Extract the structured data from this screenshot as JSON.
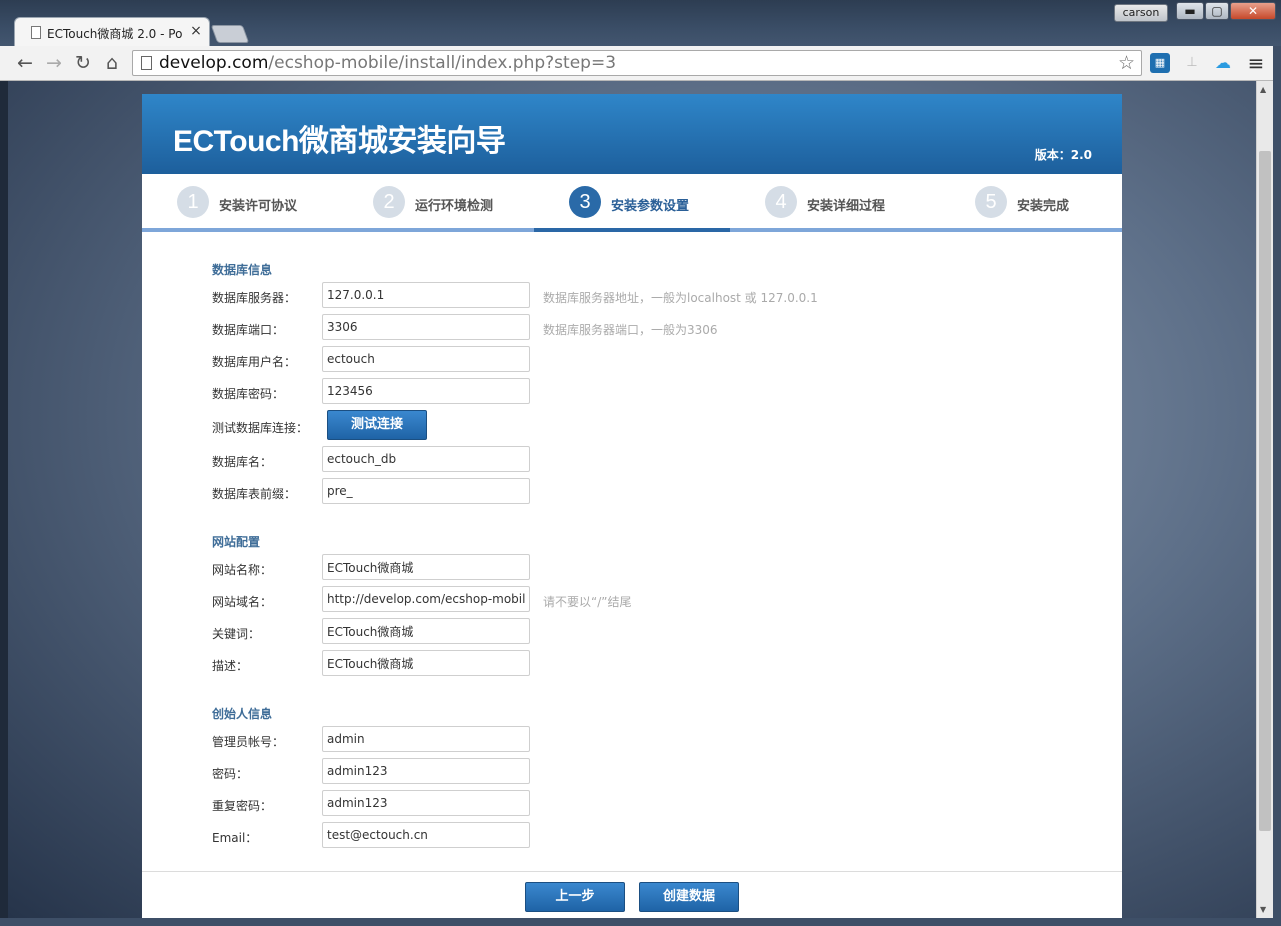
{
  "browser": {
    "tab_title": "ECTouch微商城 2.0 - Po",
    "tab_close": "×",
    "user": "carson",
    "minimize": "▬",
    "maximize": "▢",
    "close": "✕",
    "url_host": "develop.com",
    "url_path": "/ecshop-mobile/install/index.php?step=3",
    "back": "←",
    "forward": "→",
    "reload": "↻",
    "home": "⌂",
    "star": "☆",
    "menu": "≡"
  },
  "header": {
    "title": "ECTouch微商城安装向导",
    "version": "版本：2.0"
  },
  "steps": [
    {
      "num": "1",
      "label": "安装许可协议"
    },
    {
      "num": "2",
      "label": "运行环境检测"
    },
    {
      "num": "3",
      "label": "安装参数设置"
    },
    {
      "num": "4",
      "label": "安装详细过程"
    },
    {
      "num": "5",
      "label": "安装完成"
    }
  ],
  "active_step": 3,
  "database": {
    "title": "数据库信息",
    "host_label": "数据库服务器：",
    "host_value": "127.0.0.1",
    "host_hint": "数据库服务器地址，一般为localhost 或 127.0.0.1",
    "port_label": "数据库端口：",
    "port_value": "3306",
    "port_hint": "数据库服务器端口，一般为3306",
    "user_label": "数据库用户名：",
    "user_value": "ectouch",
    "pass_label": "数据库密码：",
    "pass_value": "123456",
    "test_label": "测试数据库连接：",
    "test_button": "测试连接",
    "name_label": "数据库名：",
    "name_value": "ectouch_db",
    "prefix_label": "数据库表前缀：",
    "prefix_value": "pre_"
  },
  "site": {
    "title": "网站配置",
    "name_label": "网站名称：",
    "name_value": "ECTouch微商城",
    "domain_label": "网站域名：",
    "domain_value": "http://develop.com/ecshop-mobile",
    "domain_hint": "请不要以“/”结尾",
    "keywords_label": "关键词：",
    "keywords_value": "ECTouch微商城",
    "desc_label": "描述：",
    "desc_value": "ECTouch微商城"
  },
  "founder": {
    "title": "创始人信息",
    "account_label": "管理员帐号：",
    "account_value": "admin",
    "pass_label": "密码：",
    "pass_value": "admin123",
    "repass_label": "重复密码：",
    "repass_value": "admin123",
    "email_label": "Email：",
    "email_value": "test@ectouch.cn"
  },
  "actions": {
    "prev": "上一步",
    "create": "创建数据"
  },
  "colors": {
    "brand": "#1d5f9c",
    "active_step": "#2a6aa8",
    "section_title": "#3f6d98"
  }
}
